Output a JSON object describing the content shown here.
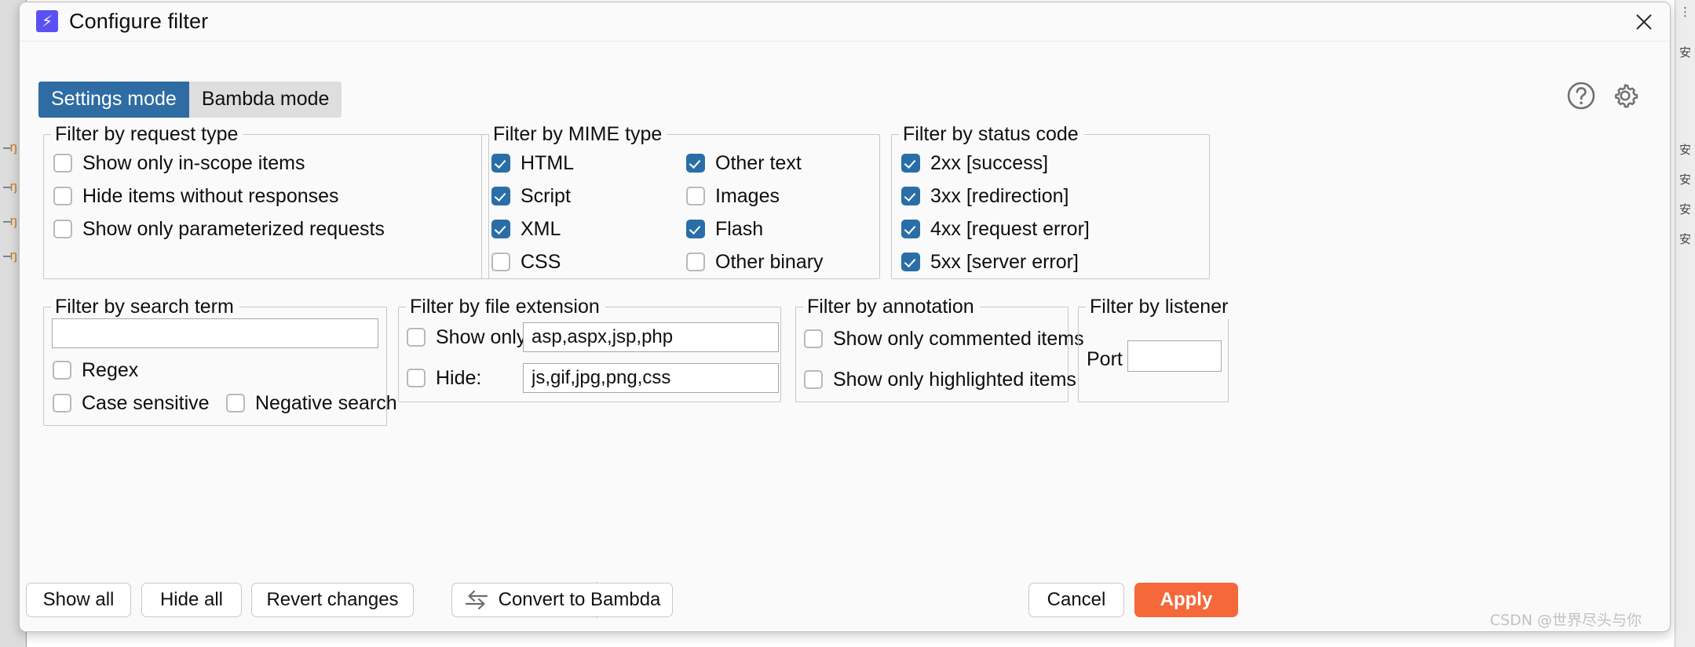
{
  "window": {
    "title": "Configure filter",
    "brand_icon": "lightning-bolt-icon",
    "close_icon": "close-icon",
    "brand_color": "#5b51f2"
  },
  "tabs": [
    {
      "label": "Settings mode",
      "active": true
    },
    {
      "label": "Bambda mode",
      "active": false
    }
  ],
  "toolbar_icons": [
    {
      "name": "help-icon"
    },
    {
      "name": "gear-icon"
    }
  ],
  "groups": {
    "request_type": {
      "legend": "Filter by request type",
      "items": [
        {
          "label": "Show only in-scope items",
          "checked": false
        },
        {
          "label": "Hide items without responses",
          "checked": false
        },
        {
          "label": "Show only parameterized requests",
          "checked": false
        }
      ]
    },
    "mime_type": {
      "legend": "Filter by MIME type",
      "column_left": [
        {
          "label": "HTML",
          "checked": true
        },
        {
          "label": "Script",
          "checked": true
        },
        {
          "label": "XML",
          "checked": true
        },
        {
          "label": "CSS",
          "checked": false
        }
      ],
      "column_right": [
        {
          "label": "Other text",
          "checked": true
        },
        {
          "label": "Images",
          "checked": false
        },
        {
          "label": "Flash",
          "checked": true
        },
        {
          "label": "Other binary",
          "checked": false
        }
      ]
    },
    "status_code": {
      "legend": "Filter by status code",
      "items": [
        {
          "label": "2xx  [success]",
          "checked": true
        },
        {
          "label": "3xx  [redirection]",
          "checked": true
        },
        {
          "label": "4xx  [request error]",
          "checked": true
        },
        {
          "label": "5xx  [server error]",
          "checked": true
        }
      ]
    },
    "search_term": {
      "legend": "Filter by search term",
      "input_value": "",
      "input_placeholder": "",
      "items": [
        {
          "label": "Regex",
          "checked": false
        },
        {
          "label": "Case sensitive",
          "checked": false
        },
        {
          "label": "Negative search",
          "checked": false
        }
      ]
    },
    "file_extension": {
      "legend": "Filter by file extension",
      "rows": [
        {
          "label": "Show only:",
          "checked": false,
          "value": "asp,aspx,jsp,php"
        },
        {
          "label": "Hide:",
          "checked": false,
          "value": "js,gif,jpg,png,css"
        }
      ]
    },
    "annotation": {
      "legend": "Filter by annotation",
      "items": [
        {
          "label": "Show only commented items",
          "checked": false
        },
        {
          "label": "Show only highlighted items",
          "checked": false
        }
      ]
    },
    "listener": {
      "legend": "Filter by listener",
      "port_label": "Port",
      "port_value": "",
      "port_placeholder": ""
    }
  },
  "footer": {
    "show_all": "Show all",
    "hide_all": "Hide all",
    "revert_changes": "Revert changes",
    "convert": "Convert to Bambda",
    "convert_icon": "swap-arrows-icon",
    "cancel": "Cancel",
    "apply": "Apply",
    "apply_color": "#f4683a"
  },
  "watermark": "CSDN @世界尽头与你"
}
